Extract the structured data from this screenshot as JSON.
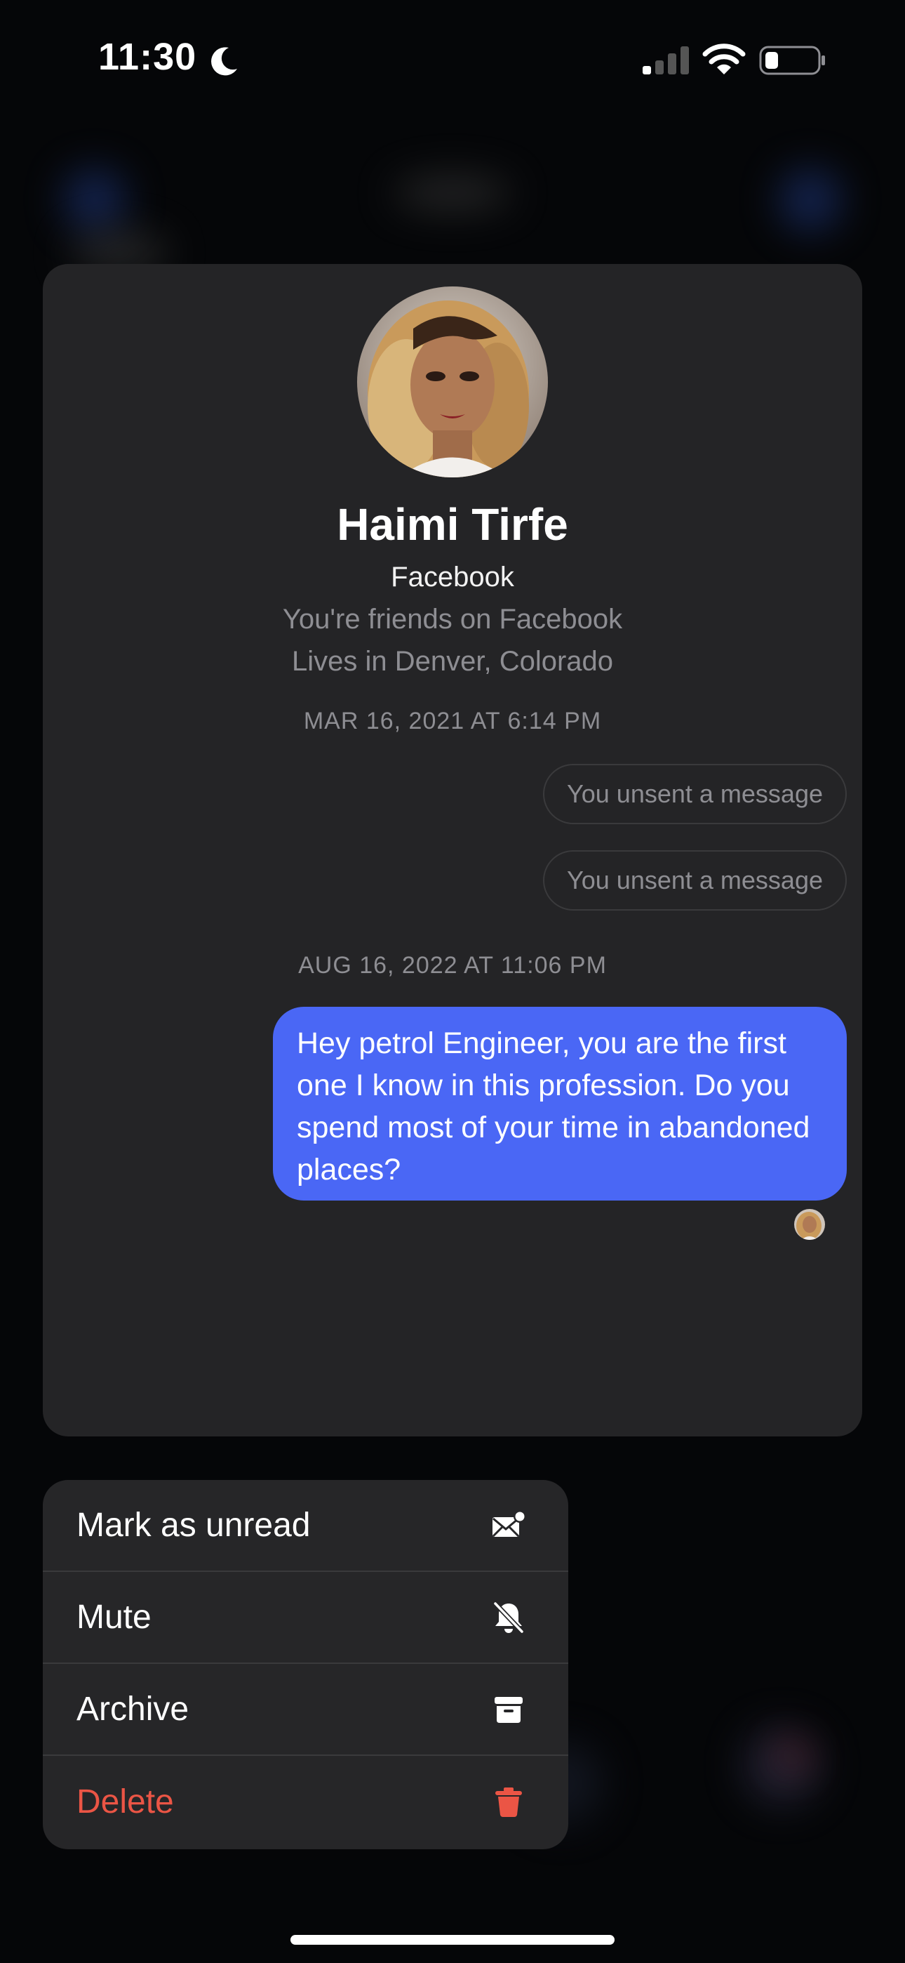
{
  "status_bar": {
    "time": "11:30"
  },
  "profile": {
    "name": "Haimi Tirfe",
    "source": "Facebook",
    "friends_note": "You're friends on Facebook",
    "location": "Lives in Denver, Colorado"
  },
  "conversation": {
    "timestamp_1": "MAR 16, 2021 AT 6:14 PM",
    "unsent_1": "You unsent a message",
    "unsent_2": "You unsent a message",
    "timestamp_2": "AUG 16, 2022 AT 11:06 PM",
    "message": "Hey petrol Engineer, you are the first one I know in this profession. Do you spend most of your time in abandoned places?"
  },
  "menu": {
    "mark_unread": "Mark as unread",
    "mute": "Mute",
    "archive": "Archive",
    "delete": "Delete"
  },
  "colors": {
    "bubble": "#4a67f5",
    "delete": "#eb5545",
    "card": "#242426"
  },
  "icons": {
    "mark_unread": "envelope-badge-icon",
    "mute": "bell-slash-icon",
    "archive": "archive-box-icon",
    "delete": "trash-icon"
  }
}
